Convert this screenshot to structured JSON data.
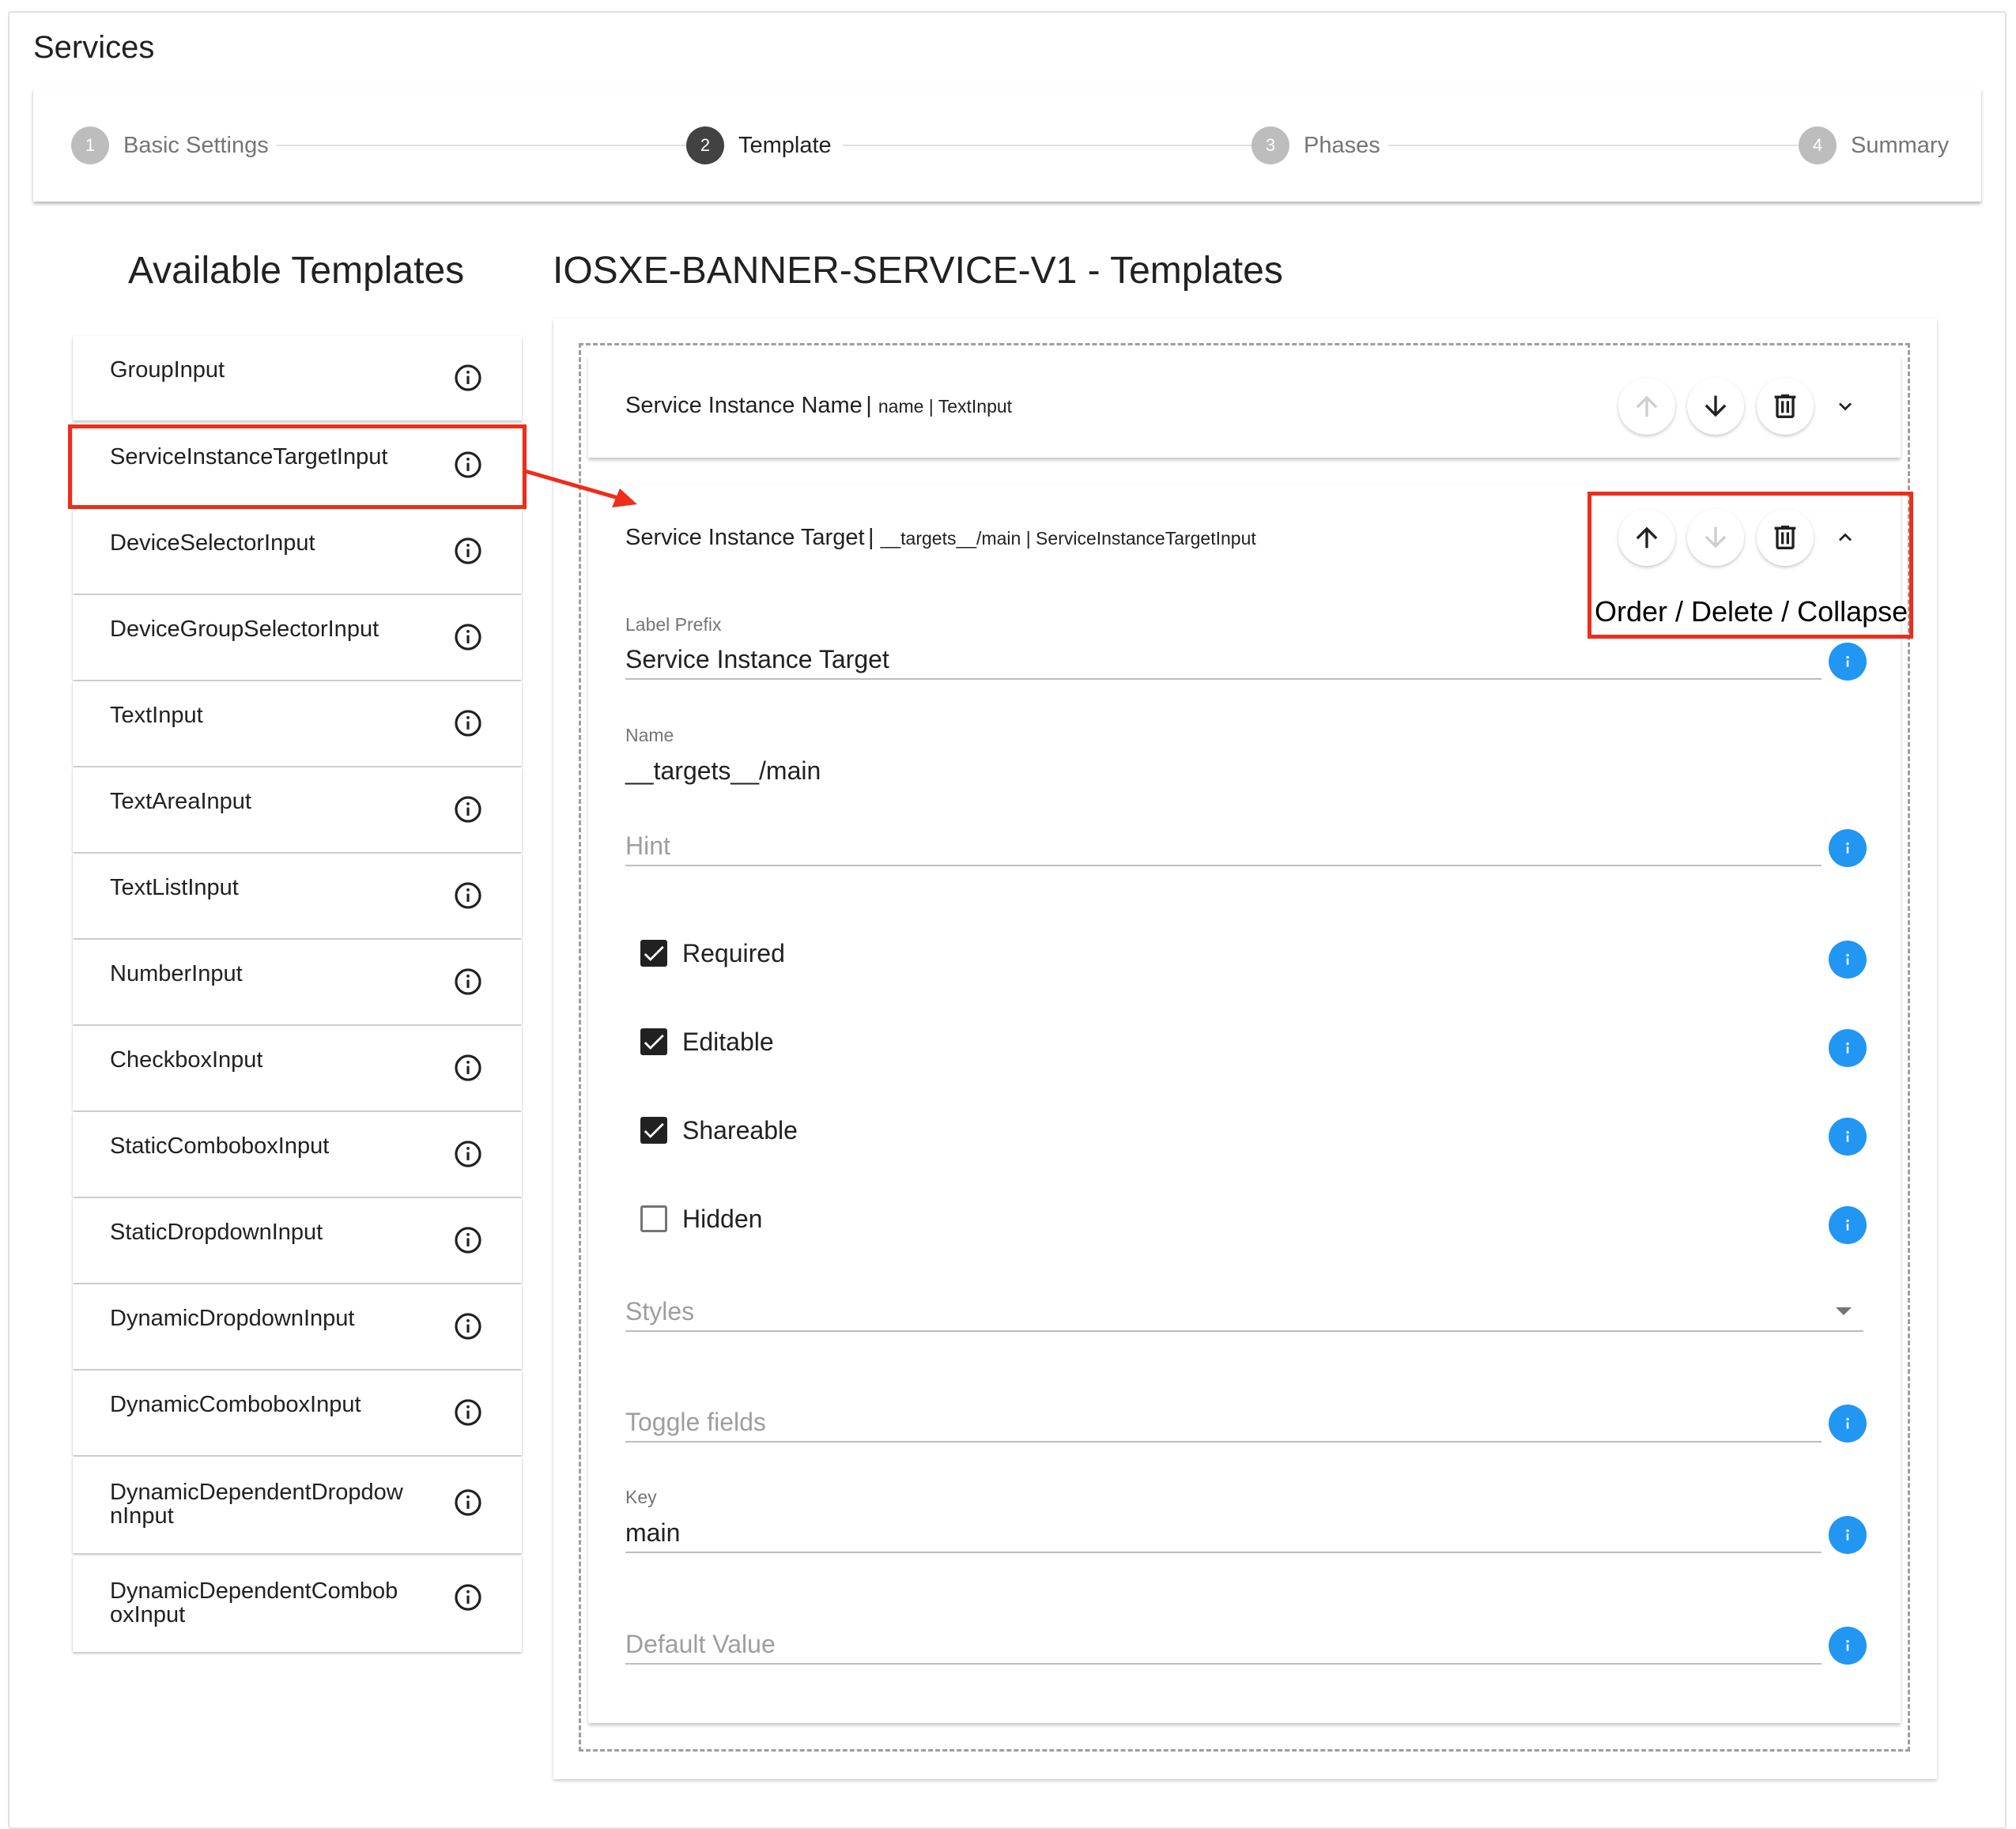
{
  "page": {
    "title": "Services"
  },
  "stepper": {
    "steps": [
      {
        "number": "1",
        "label": "Basic Settings",
        "state": "inactive"
      },
      {
        "number": "2",
        "label": "Template",
        "state": "active"
      },
      {
        "number": "3",
        "label": "Phases",
        "state": "inactive"
      },
      {
        "number": "4",
        "label": "Summary",
        "state": "inactive"
      }
    ]
  },
  "templates_panel": {
    "title": "Available Templates",
    "items": [
      "GroupInput",
      "ServiceInstanceTargetInput",
      "DeviceSelectorInput",
      "DeviceGroupSelectorInput",
      "TextInput",
      "TextAreaInput",
      "TextListInput",
      "NumberInput",
      "CheckboxInput",
      "StaticComboboxInput",
      "StaticDropdownInput",
      "DynamicDropdownInput",
      "DynamicComboboxInput",
      "DynamicDependentDropdow\nnInput",
      "DynamicDependentCombob\noxInput"
    ],
    "item_icon": "info-outline-icon"
  },
  "editor": {
    "title": "IOSXE-BANNER-SERVICE-V1 - Templates",
    "rows": [
      {
        "title": "Service Instance Name",
        "meta": "name | TextInput",
        "collapsed": true,
        "buttons": {
          "up": "arrow-up-icon",
          "down": "arrow-down-icon",
          "delete": "trash-icon",
          "toggle": "chevron-down-icon"
        }
      },
      {
        "title": "Service Instance Target",
        "meta": "__targets__/main | ServiceInstanceTargetInput",
        "collapsed": false,
        "buttons": {
          "up": "arrow-up-icon",
          "down": "arrow-down-icon",
          "delete": "trash-icon",
          "toggle": "chevron-up-icon"
        }
      }
    ],
    "form": {
      "label_prefix": {
        "label": "Label Prefix",
        "value": "Service Instance Target"
      },
      "name": {
        "label": "Name",
        "value": "__targets__/main"
      },
      "hint": {
        "placeholder": "Hint"
      },
      "checkboxes": [
        {
          "label": "Required",
          "checked": true
        },
        {
          "label": "Editable",
          "checked": true
        },
        {
          "label": "Shareable",
          "checked": true
        },
        {
          "label": "Hidden",
          "checked": false
        }
      ],
      "styles": {
        "placeholder": "Styles"
      },
      "toggle_fields": {
        "placeholder": "Toggle fields"
      },
      "key": {
        "label": "Key",
        "value": "main"
      },
      "default_value": {
        "placeholder": "Default Value"
      }
    }
  },
  "annotations": {
    "order_delete_collapse": "Order / Delete / Collapse",
    "highlight_color": "#ee2d1a"
  },
  "colors": {
    "info_blue": "#2196f3",
    "stepper_active": "#424242",
    "stepper_inactive": "#bdbdbd"
  }
}
